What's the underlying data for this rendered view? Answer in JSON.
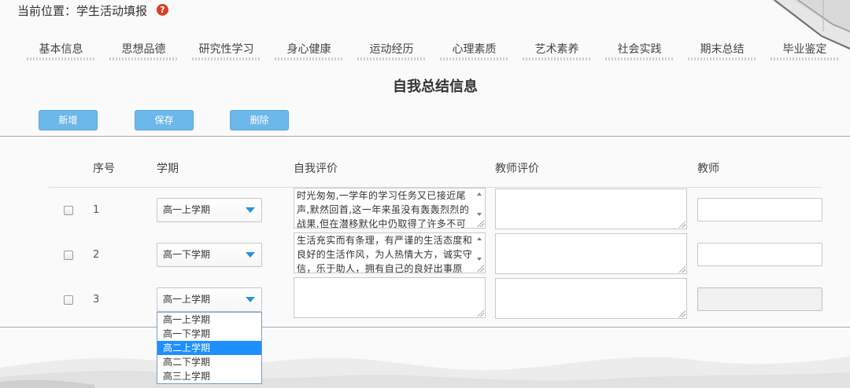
{
  "breadcrumb": {
    "text": "当前位置：学生活动填报",
    "help_icon": "question-circle-icon"
  },
  "tabs": [
    {
      "label": "基本信息"
    },
    {
      "label": "思想品德"
    },
    {
      "label": "研究性学习"
    },
    {
      "label": "身心健康"
    },
    {
      "label": "运动经历"
    },
    {
      "label": "心理素质"
    },
    {
      "label": "艺术素养"
    },
    {
      "label": "社会实践"
    },
    {
      "label": "期末总结"
    },
    {
      "label": "毕业鉴定"
    }
  ],
  "section_title": "自我总结信息",
  "toolbar": {
    "add_label": "新增",
    "save_label": "保存",
    "delete_label": "删除"
  },
  "table": {
    "columns": {
      "index": "序号",
      "term": "学期",
      "self_evaluation": "自我评价",
      "teacher_evaluation": "教师评价",
      "teacher": "教师"
    },
    "rows": [
      {
        "index": "1",
        "checked": false,
        "term": "高一上学期",
        "self_evaluation": "时光匆匆,一学年的学习任务又已接近尾声,默然回首,这一年来虽没有轰轰烈烈的战果,但在潜移默化中仍取得了许多不可",
        "teacher_evaluation": "",
        "teacher": ""
      },
      {
        "index": "2",
        "checked": false,
        "term": "高一下学期",
        "self_evaluation": "生活充实而有条理，有严谨的生活态度和良好的生活作风，为人热情大方，诚实守信，乐于助人，拥有自己的良好出事原",
        "teacher_evaluation": "",
        "teacher": ""
      },
      {
        "index": "3",
        "checked": false,
        "term": "高一上学期",
        "self_evaluation": "",
        "teacher_evaluation": "",
        "teacher": "",
        "term_options": [
          {
            "label": "高一上学期",
            "highlighted": false
          },
          {
            "label": "高一下学期",
            "highlighted": false
          },
          {
            "label": "高二上学期",
            "highlighted": true
          },
          {
            "label": "高二下学期",
            "highlighted": false
          },
          {
            "label": "高三上学期",
            "highlighted": false
          }
        ]
      }
    ]
  },
  "icons": {
    "help": "question-circle-icon",
    "select_caret": "caret-down-icon",
    "scroll_up": "scroll-up-arrow-icon",
    "scroll_down": "scroll-down-arrow-icon",
    "resize": "resize-grip-icon"
  },
  "colors": {
    "button_bg": "#6cb8ea",
    "highlight": "#1e8fff",
    "caret": "#2a94d4",
    "help_icon": "#d6402a"
  }
}
